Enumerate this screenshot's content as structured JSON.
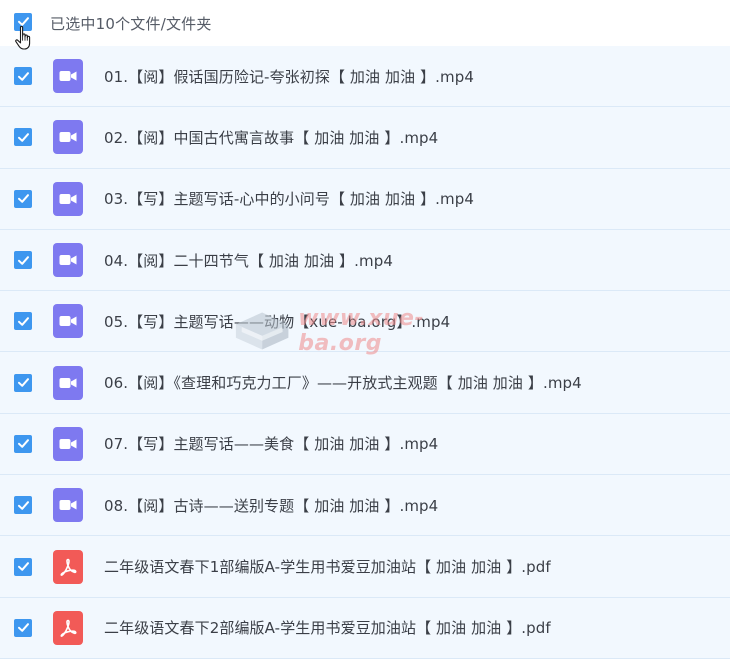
{
  "header": {
    "selection_text": "已选中10个文件/文件夹",
    "select_all_checked": true
  },
  "files": [
    {
      "name": "01.【阅】假话国历险记-夸张初探【 加油 加油 】.mp4",
      "type": "video",
      "checked": true
    },
    {
      "name": "02.【阅】中国古代寓言故事【 加油 加油 】.mp4",
      "type": "video",
      "checked": true
    },
    {
      "name": "03.【写】主题写话-心中的小问号【 加油 加油 】.mp4",
      "type": "video",
      "checked": true
    },
    {
      "name": "04.【阅】二十四节气【 加油 加油 】.mp4",
      "type": "video",
      "checked": true
    },
    {
      "name": "05.【写】主题写话——动物【xue- ba.org】.mp4",
      "type": "video",
      "checked": true
    },
    {
      "name": "06.【阅】《查理和巧克力工厂》——开放式主观题【 加油 加油 】.mp4",
      "type": "video",
      "checked": true
    },
    {
      "name": "07.【写】主题写话——美食【 加油 加油 】.mp4",
      "type": "video",
      "checked": true
    },
    {
      "name": "08.【阅】古诗——送别专题【 加油 加油 】.mp4",
      "type": "video",
      "checked": true
    },
    {
      "name": "二年级语文春下1部编版A-学生用书爱豆加油站【 加油 加油 】.pdf",
      "type": "pdf",
      "checked": true
    },
    {
      "name": "二年级语文春下2部编版A-学生用书爱豆加油站【 加油 加油 】.pdf",
      "type": "pdf",
      "checked": true
    }
  ],
  "watermark": {
    "text": "www.xue-ba.org"
  },
  "icons": {
    "checkbox": "checkmark-icon",
    "video": "video-camera-icon",
    "pdf": "pdf-acrobat-icon",
    "cursor": "hand-pointer-icon"
  },
  "colors": {
    "checkbox_blue": "#3e97ef",
    "row_background": "#f2f8fe",
    "row_border": "#dbe9f7",
    "video_icon": "#7e79f0",
    "pdf_icon": "#f25a57",
    "text": "#3b3f47"
  }
}
